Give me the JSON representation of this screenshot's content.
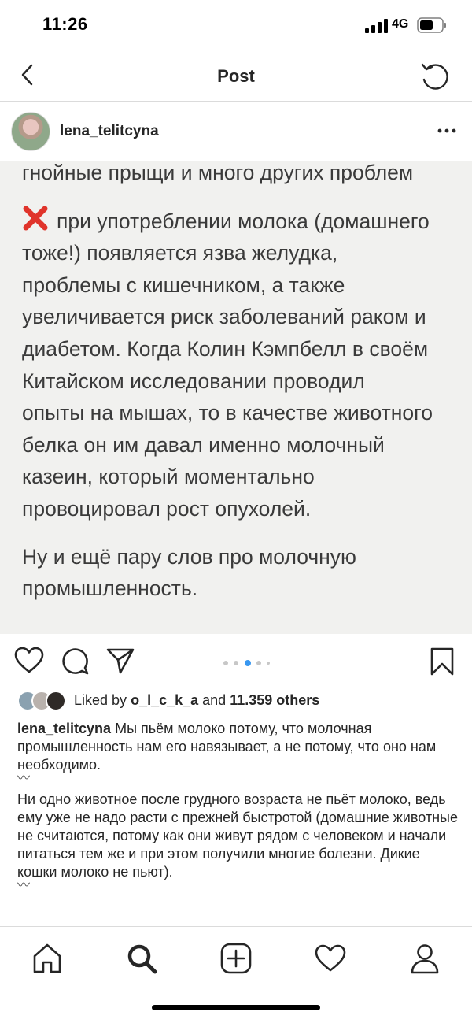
{
  "status_bar": {
    "time": "11:26",
    "network": "4G"
  },
  "nav": {
    "title": "Post",
    "back_icon": "chevron-left-icon",
    "refresh_icon": "refresh-icon"
  },
  "post": {
    "username": "lena_telitcyna",
    "image_text": {
      "line_top": "гнойные прыщи и много других проблем",
      "paragraph1": [
        "при употреблении молока (домашнего",
        "тоже!) появляется язва желудка,",
        "проблемы с кишечником, а также",
        "увеличивается риск заболеваний раком и",
        "диабетом. Когда Колин Кэмпбелл в своём",
        "Китайском исследовании проводил",
        "опыты на мышах, то в качестве животного",
        "белка он им давал именно молочный",
        "казеин, который моментально",
        "провоцировал рост опухолей."
      ],
      "paragraph2": [
        "Ну и ещё пару слов про молочную",
        "промышленность."
      ]
    },
    "carousel": {
      "count": 5,
      "active_index": 2
    },
    "likes": {
      "prefix": "Liked by",
      "user": "o_l_c_k_a",
      "and": "and",
      "others": "11.359 others"
    },
    "caption": {
      "username": "lena_telitcyna",
      "text": "Мы пьём молоко потому, что молочная промышленность нам его навязывает, а не потому, что оно нам необходимо.",
      "wave1": "〰",
      "text2": "Ни одно животное после грудного возраста не пьёт молоко, ведь ему уже не надо расти с прежней быстротой (домашние животные не считаются, потому как они живут рядом с человеком и начали питаться тем же и при этом получили многие болезни. Дикие кошки молоко не пьют).",
      "wave2": "〰"
    }
  },
  "tab_bar": {
    "items": [
      "home-icon",
      "search-icon",
      "new-post-icon",
      "activity-heart-icon",
      "profile-icon"
    ],
    "active": "search-icon"
  },
  "colors": {
    "text": "#262626",
    "border": "#dbdbdb",
    "carousel_active": "#3897f0",
    "red_x": "#e0342b"
  }
}
